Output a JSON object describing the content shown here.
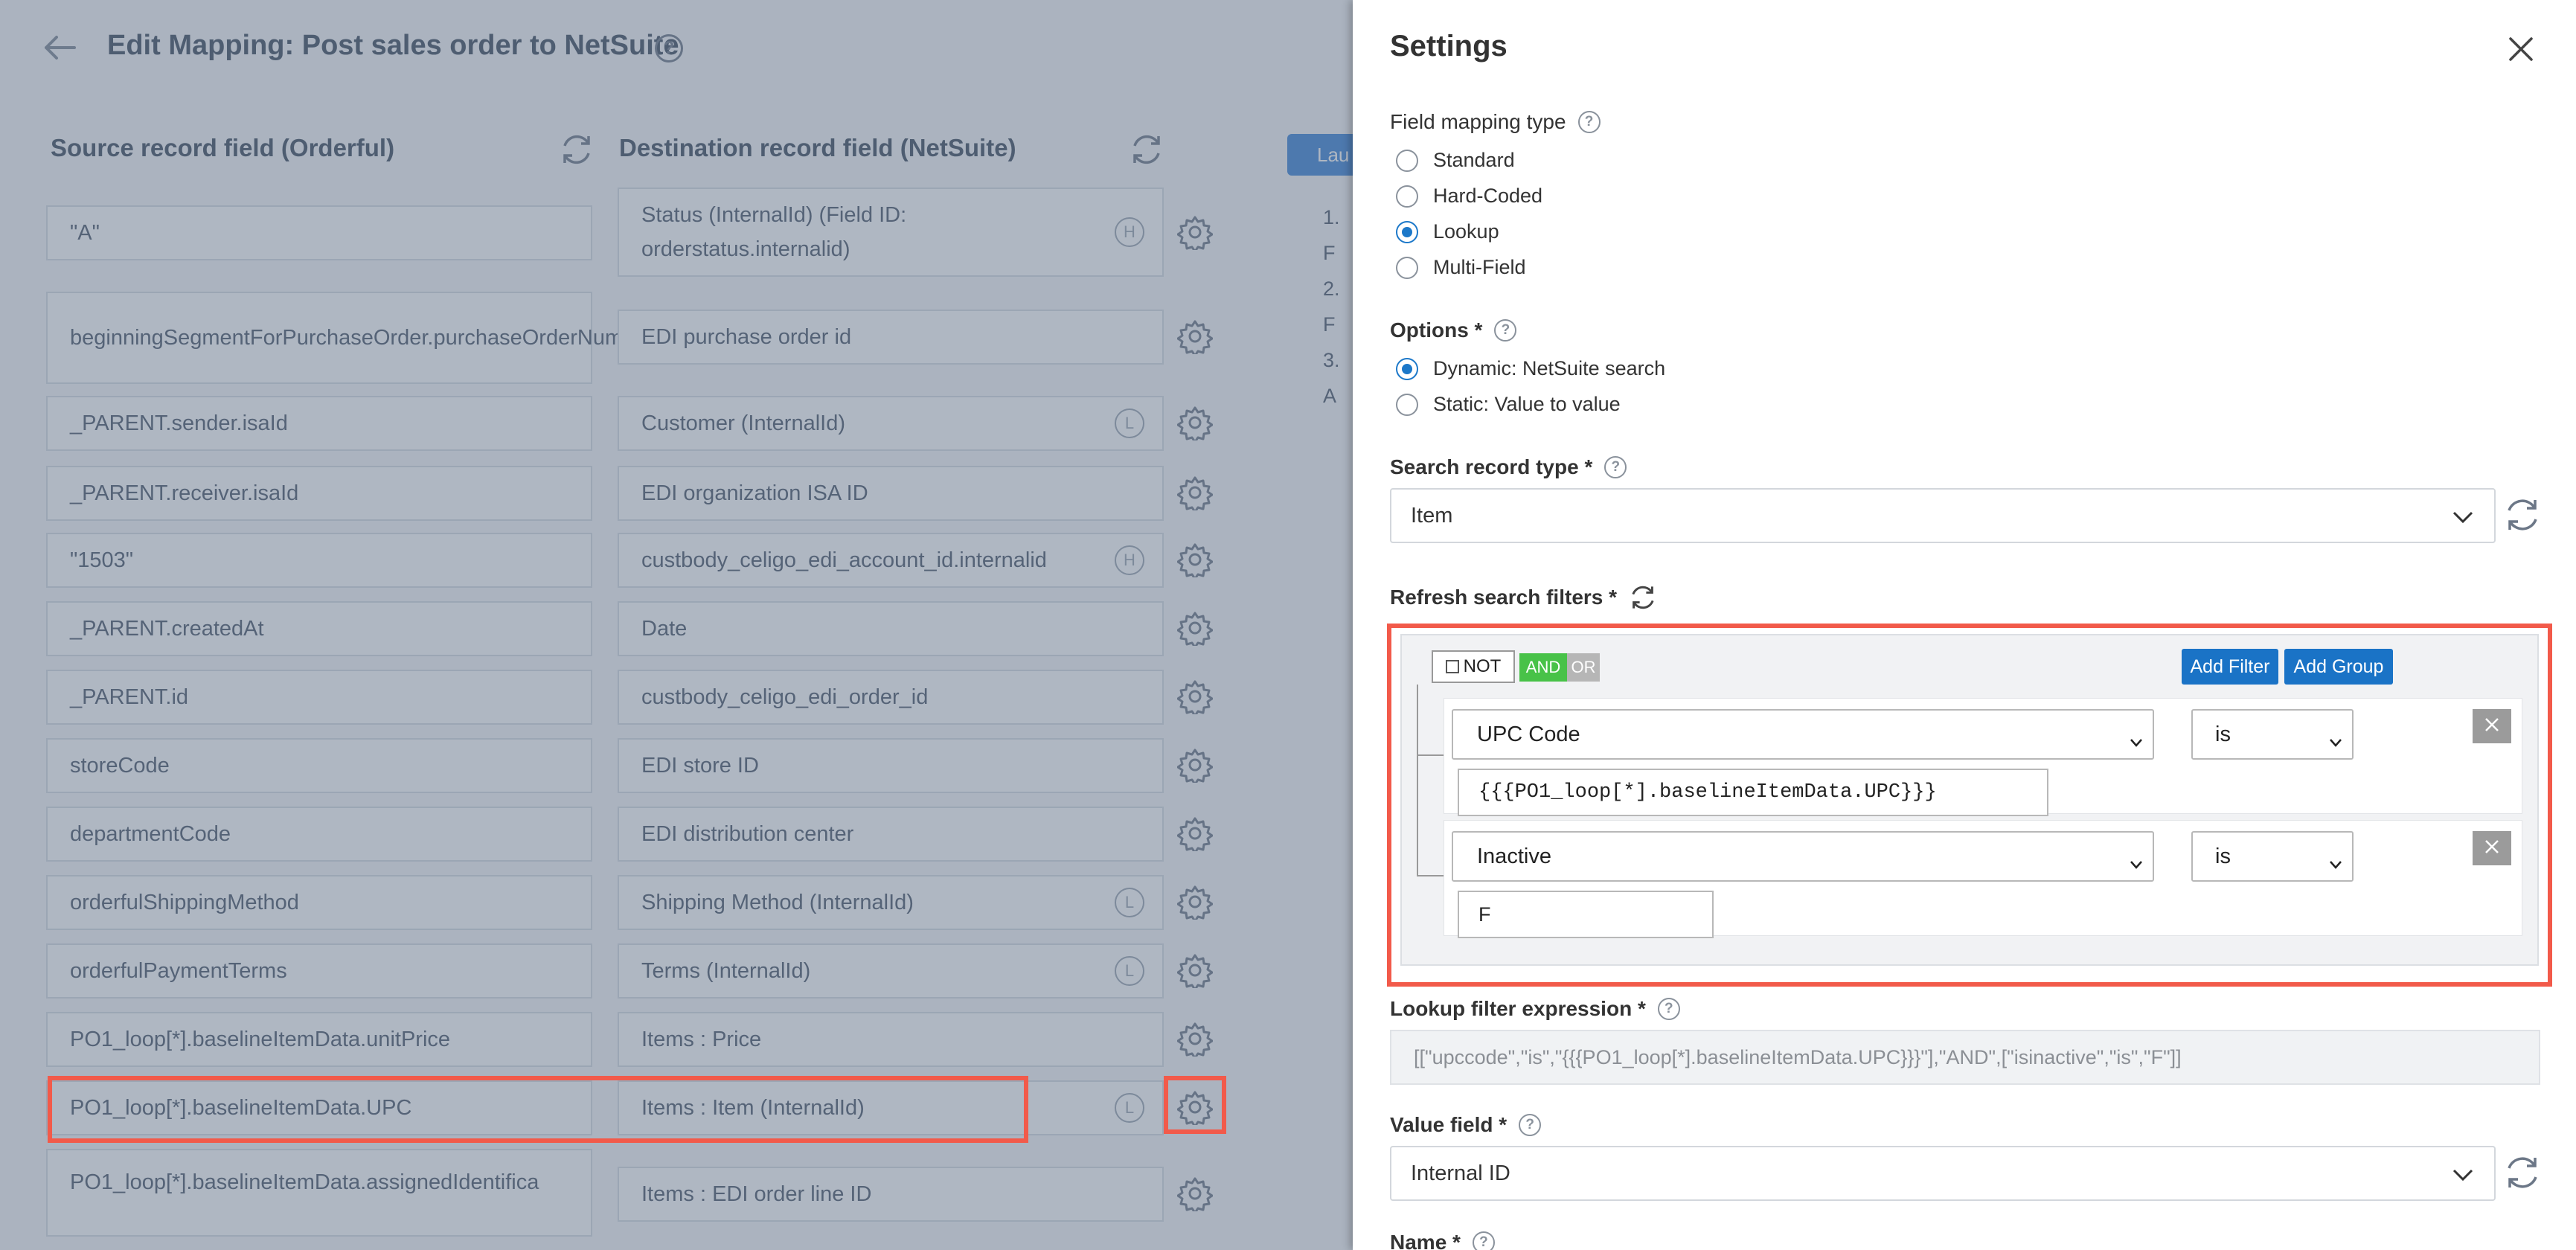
{
  "page": {
    "title": "Edit Mapping: Post sales order to NetSuite",
    "source_header": "Source record field (Orderful)",
    "destination_header": "Destination record field (NetSuite)",
    "launch_button": "Lau",
    "steps": [
      "1. F",
      "2. F",
      "3. A"
    ]
  },
  "mappings": [
    {
      "source": "\"A\"",
      "destination": "Status (InternalId) (Field ID: orderstatus.internalid)",
      "badge": "H"
    },
    {
      "source": "beginningSegmentForPurchaseOrder.purchaseOrderNumber",
      "destination": "EDI purchase order id",
      "badge": ""
    },
    {
      "source": "_PARENT.sender.isaId",
      "destination": "Customer (InternalId)",
      "badge": "L"
    },
    {
      "source": "_PARENT.receiver.isaId",
      "destination": "EDI organization ISA ID",
      "badge": ""
    },
    {
      "source": "\"1503\"",
      "destination": "custbody_celigo_edi_account_id.internalid",
      "badge": "H"
    },
    {
      "source": "_PARENT.createdAt",
      "destination": "Date",
      "badge": ""
    },
    {
      "source": "_PARENT.id",
      "destination": "custbody_celigo_edi_order_id",
      "badge": ""
    },
    {
      "source": "storeCode",
      "destination": "EDI store ID",
      "badge": ""
    },
    {
      "source": "departmentCode",
      "destination": "EDI distribution center",
      "badge": ""
    },
    {
      "source": "orderfulShippingMethod",
      "destination": "Shipping Method (InternalId)",
      "badge": "L"
    },
    {
      "source": "orderfulPaymentTerms",
      "destination": "Terms (InternalId)",
      "badge": "L"
    },
    {
      "source": "PO1_loop[*].baselineItemData.unitPrice",
      "destination": "Items : Price",
      "badge": ""
    },
    {
      "source": "PO1_loop[*].baselineItemData.UPC",
      "destination": "Items : Item (InternalId)",
      "badge": "L"
    },
    {
      "source": "PO1_loop[*].baselineItemData.assignedIdentifica",
      "destination": "Items : EDI order line ID",
      "badge": ""
    }
  ],
  "settings": {
    "title": "Settings",
    "field_mapping_type_label": "Field mapping type",
    "mapping_types": [
      "Standard",
      "Hard-Coded",
      "Lookup",
      "Multi-Field"
    ],
    "mapping_type_selected": "Lookup",
    "options_label": "Options *",
    "options": [
      "Dynamic: NetSuite search",
      "Static: Value to value"
    ],
    "option_selected": "Dynamic: NetSuite search",
    "search_record_type_label": "Search record type *",
    "search_record_type_value": "Item",
    "refresh_filters_label": "Refresh search filters *",
    "filter": {
      "not_label": "NOT",
      "and_label": "AND",
      "or_label": "OR",
      "add_filter": "Add Filter",
      "add_group": "Add Group",
      "rules": [
        {
          "field": "UPC Code",
          "operator": "is",
          "value": "{{{PO1_loop[*].baselineItemData.UPC}}}"
        },
        {
          "field": "Inactive",
          "operator": "is",
          "value": "F"
        }
      ]
    },
    "lookup_expression_label": "Lookup filter expression *",
    "lookup_expression_value": "[[\"upccode\",\"is\",\"{{{PO1_loop[*].baselineItemData.UPC}}}\"],\"AND\",[\"isinactive\",\"is\",\"F\"]]",
    "value_field_label": "Value field *",
    "value_field_value": "Internal ID",
    "name_label": "Name *"
  },
  "colors": {
    "highlight": "#f25a4a",
    "primary": "#1a73c6",
    "and_active": "#48c248"
  }
}
